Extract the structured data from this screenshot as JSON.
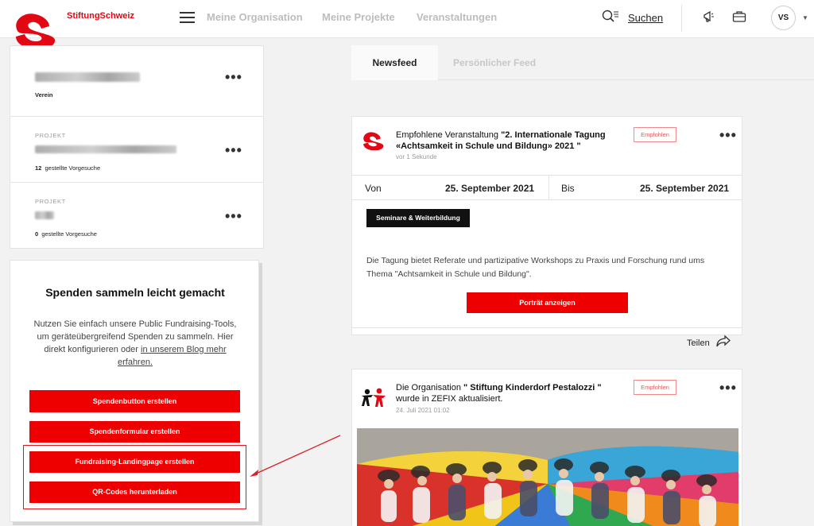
{
  "brand": "StiftungSchweiz",
  "nav": {
    "links": [
      "Meine Organisation",
      "Meine Projekte",
      "Veranstaltungen"
    ],
    "search_label": "Suchen",
    "avatar_initials": "VS"
  },
  "sidebar": {
    "org": {
      "type": "Verein"
    },
    "projects": [
      {
        "caption": "PROJEKT",
        "count": "12",
        "count_suffix": "gestellte Vorgesuche"
      },
      {
        "caption": "PROJEKT",
        "count": "0",
        "count_suffix": "gestellte Vorgesuche"
      }
    ]
  },
  "fundraising": {
    "title": "Spenden sammeln leicht gemacht",
    "text_1": "Nutzen Sie einfach unsere Public Fundraising-Tools, um geräteübergreifend Spenden zu sammeln. Hier direkt konfigurieren oder",
    "text_link": "in unserem Blog mehr erfahren.",
    "buttons": [
      "Spendenbutton erstellen",
      "Spendenformular erstellen",
      "Fundraising-Landingpage erstellen",
      "QR-Codes herunterladen"
    ]
  },
  "feed": {
    "tabs": [
      "Newsfeed",
      "Persönlicher Feed"
    ],
    "post1": {
      "prefix": "Empfohlene Veranstaltung ",
      "title_bold": "\"2. Internationale Tagung «Achtsamkeit in Schule und Bildung» 2021 \"",
      "time": "vor 1 Sekunde",
      "badge": "Empfohlen",
      "from_label": "Von",
      "from_date": "25. September 2021",
      "to_label": "Bis",
      "to_date": "25. September 2021",
      "tag": "Seminare & Weiterbildung",
      "description": "Die Tagung bietet Referate und partizipative Workshops zu Praxis und Forschung rund ums Thema \"Achtsamkeit in Schule und Bildung\".",
      "cta": "Porträt anzeigen",
      "share": "Teilen"
    },
    "post2": {
      "prefix": "Die Organisation ",
      "title_bold": "\" Stiftung Kinderdorf Pestalozzi \"",
      "suffix": " wurde in ZEFIX aktualisiert.",
      "time": "24. Juli 2021 01:02",
      "badge": "Empfohlen"
    }
  },
  "colors": {
    "brand_red": "#e30613",
    "button_red": "#ee0000"
  }
}
